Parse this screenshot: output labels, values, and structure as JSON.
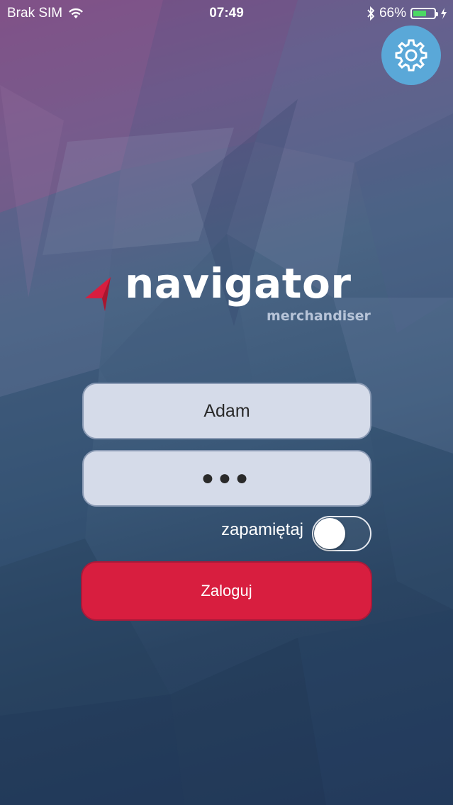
{
  "status_bar": {
    "carrier": "Brak SIM",
    "time": "07:49",
    "battery_percent": "66%",
    "battery_level": 0.66,
    "icons": [
      "wifi-icon",
      "bluetooth-icon",
      "battery-icon",
      "charging-icon"
    ]
  },
  "settings": {
    "icon": "gear-icon"
  },
  "logo": {
    "name": "navigator",
    "subtitle": "merchandiser"
  },
  "form": {
    "login_value": "Adam",
    "password_mask": "●●●",
    "remember_label": "zapamiętaj",
    "remember_on": false,
    "submit_label": "Zaloguj"
  },
  "colors": {
    "accent_red": "#d81e3f",
    "settings_blue": "#5aa8d8",
    "field_bg": "#d5dbe9"
  }
}
